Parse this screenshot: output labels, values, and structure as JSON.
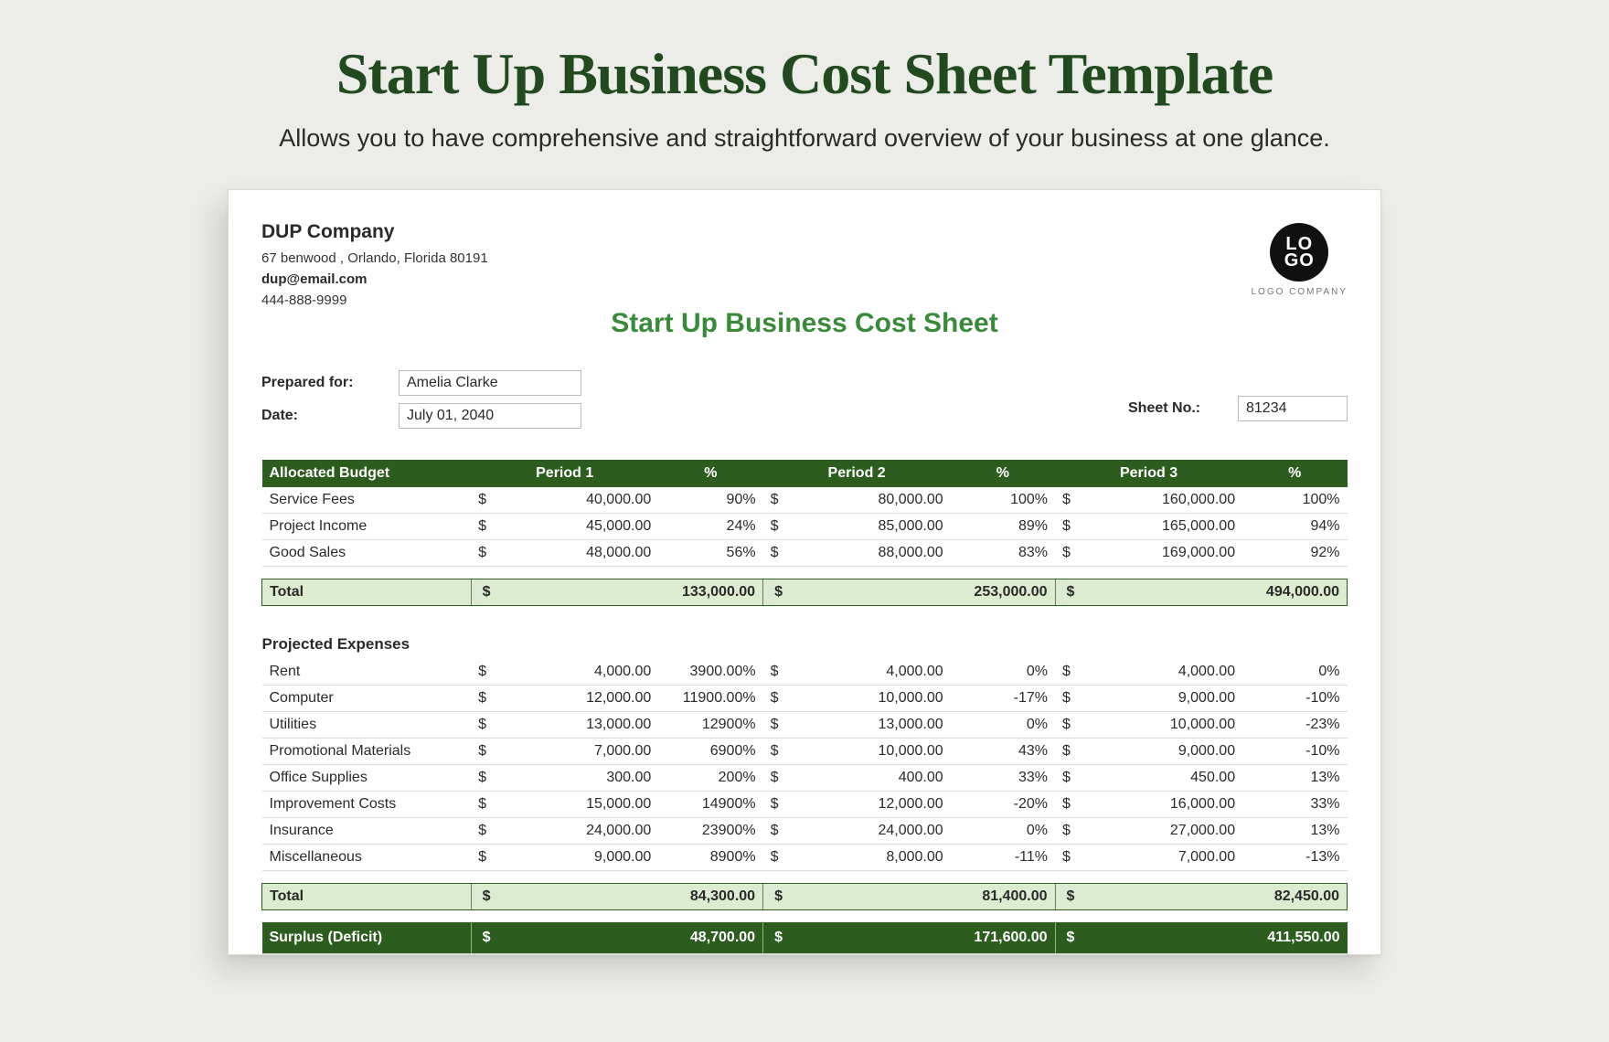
{
  "page": {
    "title": "Start Up Business Cost Sheet Template",
    "subtitle": "Allows you to have comprehensive and straightforward overview of your business at one glance."
  },
  "company": {
    "name": "DUP Company",
    "address": "67 benwood , Orlando, Florida 80191",
    "email": "dup@email.com",
    "phone": "444-888-9999"
  },
  "logo": {
    "top": "LO",
    "bottom": "GO",
    "label": "LOGO COMPANY"
  },
  "sheet_title": "Start Up Business Cost Sheet",
  "meta": {
    "prepared_for_label": "Prepared for:",
    "prepared_for": "Amelia Clarke",
    "date_label": "Date:",
    "date": "July 01, 2040",
    "sheet_no_label": "Sheet No.:",
    "sheet_no": "81234"
  },
  "headers": {
    "allocated": "Allocated Budget",
    "p1": "Period 1",
    "p2": "Period 2",
    "p3": "Period 3",
    "pct": "%"
  },
  "budget": [
    {
      "label": "Service Fees",
      "p1": "40,000.00",
      "pc1": "90%",
      "p2": "80,000.00",
      "pc2": "100%",
      "p3": "160,000.00",
      "pc3": "100%"
    },
    {
      "label": "Project Income",
      "p1": "45,000.00",
      "pc1": "24%",
      "p2": "85,000.00",
      "pc2": "89%",
      "p3": "165,000.00",
      "pc3": "94%"
    },
    {
      "label": "Good Sales",
      "p1": "48,000.00",
      "pc1": "56%",
      "p2": "88,000.00",
      "pc2": "83%",
      "p3": "169,000.00",
      "pc3": "92%"
    }
  ],
  "budget_total": {
    "label": "Total",
    "p1": "133,000.00",
    "p2": "253,000.00",
    "p3": "494,000.00"
  },
  "expenses_label": "Projected Expenses",
  "expenses": [
    {
      "label": "Rent",
      "p1": "4,000.00",
      "pc1": "3900.00%",
      "p2": "4,000.00",
      "pc2": "0%",
      "p3": "4,000.00",
      "pc3": "0%"
    },
    {
      "label": "Computer",
      "p1": "12,000.00",
      "pc1": "11900.00%",
      "p2": "10,000.00",
      "pc2": "-17%",
      "p3": "9,000.00",
      "pc3": "-10%"
    },
    {
      "label": "Utilities",
      "p1": "13,000.00",
      "pc1": "12900%",
      "p2": "13,000.00",
      "pc2": "0%",
      "p3": "10,000.00",
      "pc3": "-23%"
    },
    {
      "label": "Promotional Materials",
      "p1": "7,000.00",
      "pc1": "6900%",
      "p2": "10,000.00",
      "pc2": "43%",
      "p3": "9,000.00",
      "pc3": "-10%"
    },
    {
      "label": "Office Supplies",
      "p1": "300.00",
      "pc1": "200%",
      "p2": "400.00",
      "pc2": "33%",
      "p3": "450.00",
      "pc3": "13%"
    },
    {
      "label": "Improvement Costs",
      "p1": "15,000.00",
      "pc1": "14900%",
      "p2": "12,000.00",
      "pc2": "-20%",
      "p3": "16,000.00",
      "pc3": "33%"
    },
    {
      "label": "Insurance",
      "p1": "24,000.00",
      "pc1": "23900%",
      "p2": "24,000.00",
      "pc2": "0%",
      "p3": "27,000.00",
      "pc3": "13%"
    },
    {
      "label": "Miscellaneous",
      "p1": "9,000.00",
      "pc1": "8900%",
      "p2": "8,000.00",
      "pc2": "-11%",
      "p3": "7,000.00",
      "pc3": "-13%"
    }
  ],
  "expenses_total": {
    "label": "Total",
    "p1": "84,300.00",
    "p2": "81,400.00",
    "p3": "82,450.00"
  },
  "surplus": {
    "label": "Surplus (Deficit)",
    "p1": "48,700.00",
    "p2": "171,600.00",
    "p3": "411,550.00"
  },
  "currency": "$"
}
